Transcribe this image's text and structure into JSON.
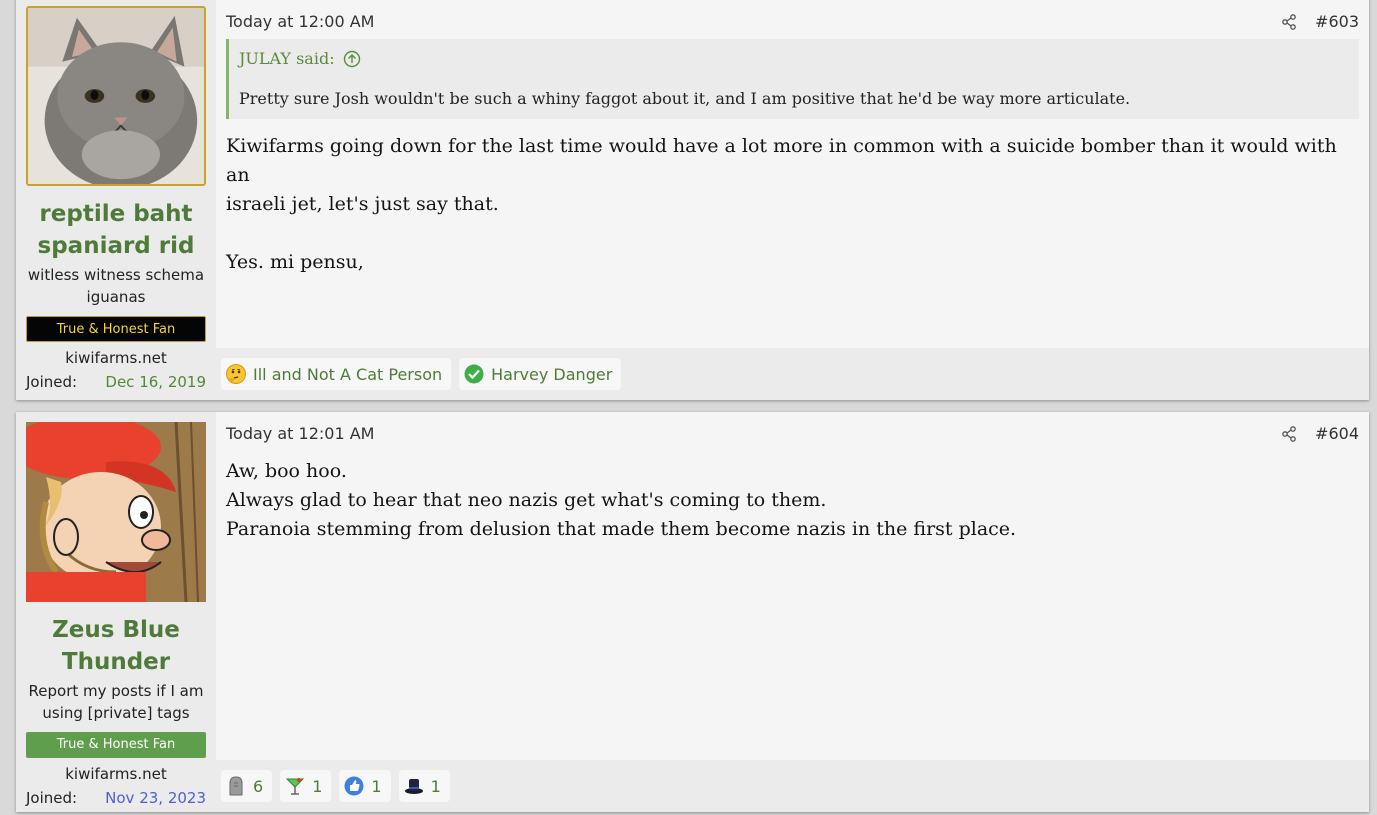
{
  "posts": [
    {
      "user": {
        "name_line1": "reptile baht",
        "name_line2": "spaniard rid",
        "title_line1": "witless witness schema",
        "title_line2": "iguanas",
        "banner": "True & Honest Fan",
        "site": "kiwifarms.net",
        "joined_label": "Joined:",
        "joined_date": "Dec 16, 2019"
      },
      "time": "Today at 12:00 AM",
      "number": "#603",
      "quote": {
        "author": "JULAY said:",
        "text": "Pretty sure Josh wouldn't be such a whiny faggot about it, and I am positive that he'd be way more articulate."
      },
      "body_lines": [
        "Kiwifarms going down for the last time would have a lot more in common with a suicide bomber than it would with an",
        "israeli jet, let's just say that.",
        "Yes. mi pensu,"
      ],
      "reactions": [
        {
          "label": "Ill and Not A Cat Person",
          "icon": "thinking-emoji-icon"
        },
        {
          "label": "Harvey Danger",
          "icon": "green-check-icon"
        }
      ]
    },
    {
      "user": {
        "name_line1": "Zeus Blue",
        "name_line2": "Thunder",
        "title_line1": "Report my posts if I am",
        "title_line2": "using [private] tags",
        "banner": "True & Honest Fan",
        "site": "kiwifarms.net",
        "joined_label": "Joined:",
        "joined_date": "Nov 23, 2023"
      },
      "time": "Today at 12:01 AM",
      "number": "#604",
      "body_lines": [
        "Aw, boo hoo.",
        "Always glad to hear that neo nazis get what's coming to them.",
        "Paranoia stemming from delusion that made them become nazis in the first place."
      ],
      "reactions": [
        {
          "count": "6",
          "icon": "gravestone-icon"
        },
        {
          "count": "1",
          "icon": "cocktail-icon"
        },
        {
          "count": "1",
          "icon": "thumbs-up-icon"
        },
        {
          "count": "1",
          "icon": "top-hat-icon"
        }
      ]
    }
  ]
}
